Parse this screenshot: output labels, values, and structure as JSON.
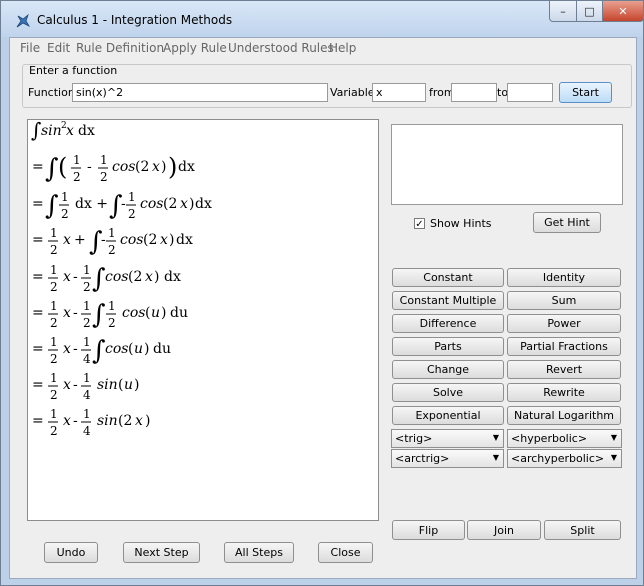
{
  "window": {
    "title": "Calculus 1 - Integration Methods",
    "min_glyph": "–",
    "max_glyph": "□",
    "close_glyph": "✕"
  },
  "menu": [
    "File",
    "Edit",
    "Rule Definition",
    "Apply Rule",
    "Understood Rules",
    "Help"
  ],
  "function_panel": {
    "group_title": "Enter a function",
    "function_label": "Function",
    "function_value": "sin(x)^2",
    "variable_label": "Variable",
    "variable_value": "x",
    "from_label": "from",
    "from_value": "",
    "to_label": "to",
    "to_value": "",
    "start_label": "Start"
  },
  "hints": {
    "show_hints_label": "Show Hints",
    "show_hints_checked": true,
    "get_hint_label": "Get Hint"
  },
  "rules": [
    "Constant",
    "Identity",
    "Constant Multiple",
    "Sum",
    "Difference",
    "Power",
    "Parts",
    "Partial Fractions",
    "Change",
    "Revert",
    "Solve",
    "Rewrite",
    "Exponential",
    "Natural Logarithm"
  ],
  "dropdowns": [
    "<trig>",
    "<hyperbolic>",
    "<arctrig>",
    "<archyperbolic>"
  ],
  "actions": {
    "flip": "Flip",
    "join": "Join",
    "split": "Split"
  },
  "bottom": {
    "undo": "Undo",
    "next_step": "Next Step",
    "all_steps": "All Steps",
    "close": "Close"
  }
}
